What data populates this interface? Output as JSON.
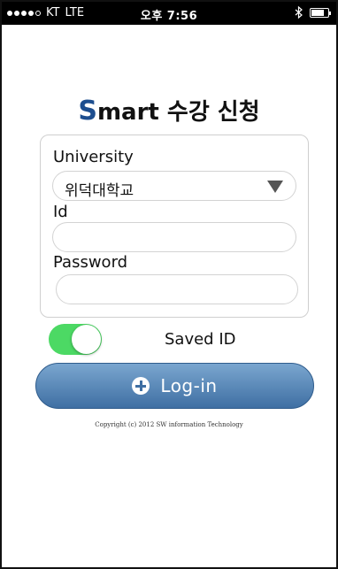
{
  "status_bar": {
    "carrier": "KT",
    "network": "LTE",
    "time": "오후 7:56",
    "signal_dots_filled": 4,
    "signal_dots_total": 5,
    "bluetooth_icon": "bluetooth-icon",
    "battery_level": 0.8
  },
  "title": {
    "s_letter": "S",
    "rest": "mart 수강 신청"
  },
  "form": {
    "university_label": "University",
    "university_value": "위덕대학교",
    "id_label": "Id",
    "id_value": "",
    "password_label": "Password",
    "password_value": ""
  },
  "saved_id": {
    "label": "Saved ID",
    "enabled": true,
    "on_color": "#4cd964"
  },
  "login_button": {
    "label": "Log-in",
    "icon": "plus-circle-icon"
  },
  "copyright": "Copyright (c) 2012 SW information Technology",
  "colors": {
    "accent": "#1d4e8f",
    "button_top": "#7aa6cf",
    "button_bottom": "#3f6fa3"
  }
}
